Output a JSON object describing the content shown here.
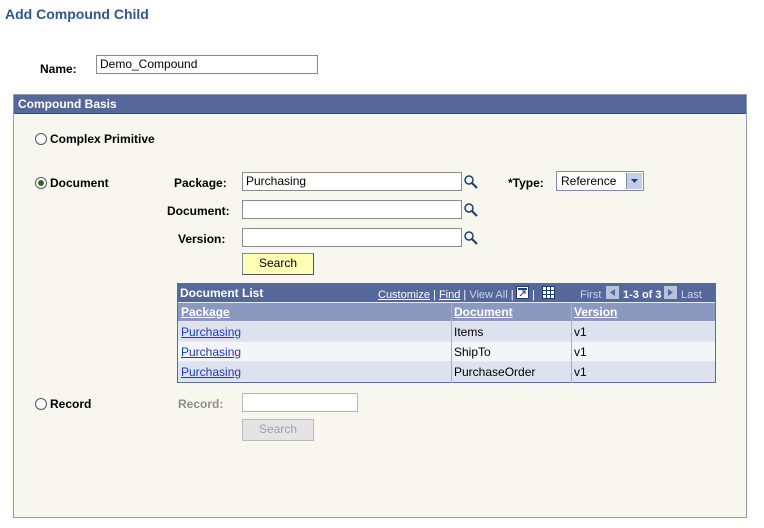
{
  "page": {
    "title": "Add Compound Child"
  },
  "name": {
    "label": "Name:",
    "value": "Demo_Compound"
  },
  "basis": {
    "title": "Compound Basis",
    "options": {
      "complex_primitive": "Complex Primitive",
      "document": "Document",
      "record": "Record"
    },
    "selected": "Document"
  },
  "document_section": {
    "package_label": "Package:",
    "package_value": "Purchasing",
    "document_label": "Document:",
    "document_value": "",
    "version_label": "Version:",
    "version_value": "",
    "type_label": "*Type:",
    "type_value": "Reference",
    "search_button": "Search"
  },
  "document_list": {
    "title": "Document List",
    "customize": "Customize",
    "find": "Find",
    "view_all": "View All",
    "first": "First",
    "range": "1-3 of 3",
    "last": "Last",
    "columns": [
      "Package",
      "Document",
      "Version"
    ],
    "rows": [
      [
        "Purchasing",
        "Items",
        "v1"
      ],
      [
        "Purchasing",
        "ShipTo",
        "v1"
      ],
      [
        "Purchasing",
        "PurchaseOrder",
        "v1"
      ]
    ]
  },
  "record_section": {
    "record_label": "Record:",
    "record_value": "",
    "search_button": "Search"
  },
  "colors": {
    "header_bg": "#56679a",
    "frame_bg": "#f7f7f0",
    "title": "#31568c",
    "link": "#1a3fb0",
    "button_active": "#ffffb8"
  }
}
